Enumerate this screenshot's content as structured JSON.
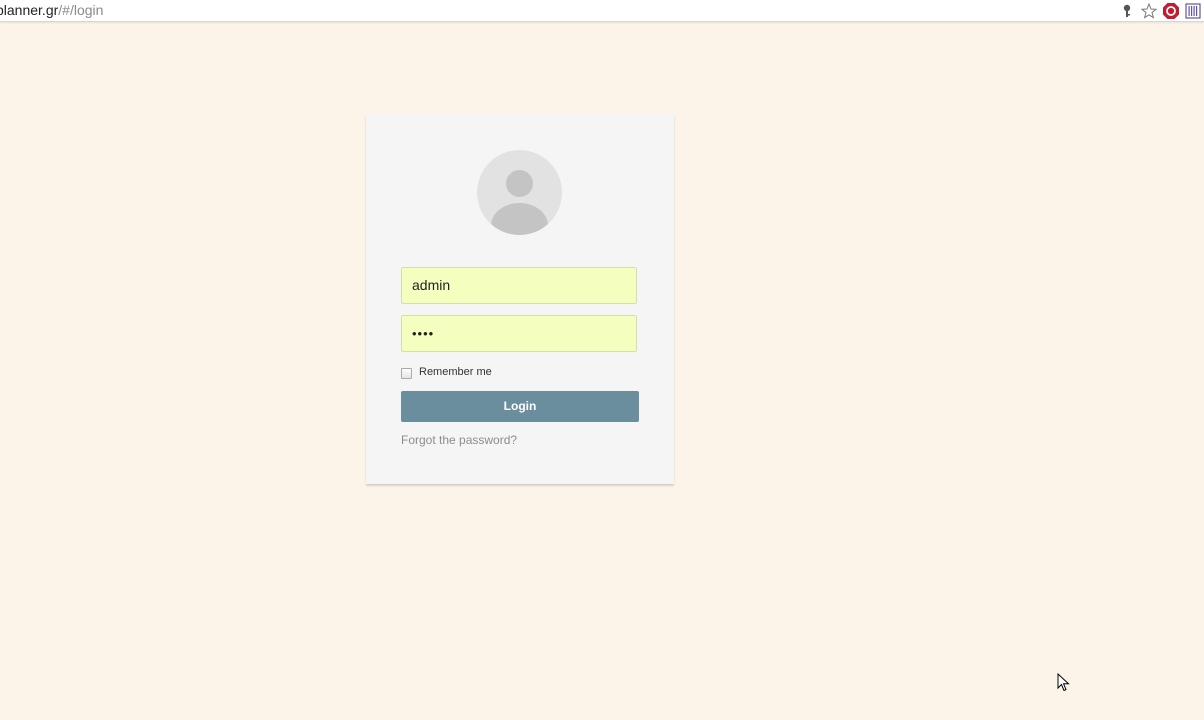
{
  "browser": {
    "url_host": "planner.gr",
    "url_path": "/#/login",
    "icons": [
      "key-icon",
      "star-icon",
      "stop-icon",
      "extension-icon"
    ]
  },
  "login": {
    "username_value": "admin",
    "password_masked": "••••",
    "remember_label": "Remember me",
    "remember_checked": false,
    "login_button": "Login",
    "forgot_link": "Forgot the password?"
  },
  "colors": {
    "page_background": "#fdf4e9",
    "card_background": "#f5f5f5",
    "input_autofill": "#f4ffbf",
    "button": "#6a8e9e",
    "link": "#8c8c8c"
  }
}
